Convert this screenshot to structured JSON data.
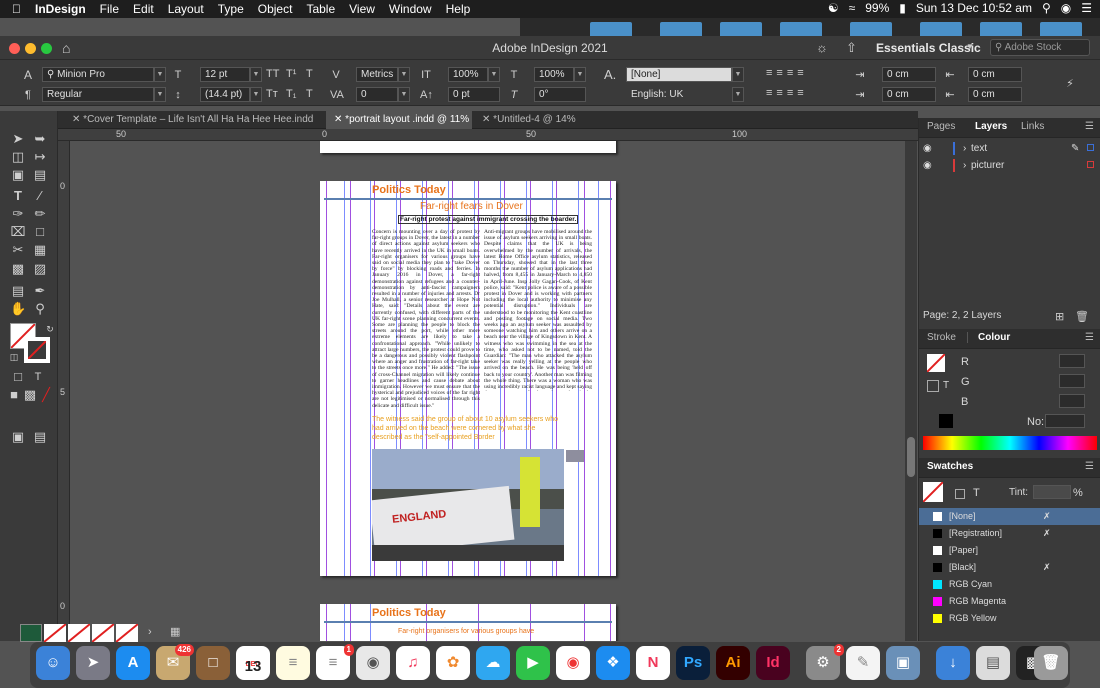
{
  "menubar": {
    "app": "InDesign",
    "items": [
      "File",
      "Edit",
      "Layout",
      "Type",
      "Object",
      "Table",
      "View",
      "Window",
      "Help"
    ],
    "battery": "99%",
    "datetime": "Sun 13 Dec  10:52 am"
  },
  "window": {
    "title": "Adobe InDesign 2021",
    "workspace": "Essentials Classic",
    "stock_placeholder": "Adobe Stock"
  },
  "control": {
    "font_family": "Minion Pro",
    "font_style": "Regular",
    "font_size": "12 pt",
    "leading": "(14.4 pt)",
    "kerning": "Metrics",
    "tracking": "0",
    "vscale": "100%",
    "hscale": "100%",
    "baseline": "0 pt",
    "skew": "0°",
    "char_style": "[None]",
    "language": "English: UK",
    "indent_left": "0 cm",
    "indent_right": "0 cm",
    "indent_first": "0 cm",
    "indent_last": "0 cm"
  },
  "tabs": [
    {
      "label": "*Cover Template – Life Isn't All Ha Ha Hee Hee.indd @ 37%",
      "active": false
    },
    {
      "label": "*portrait layout .indd @ 11%",
      "active": true
    },
    {
      "label": "*Untitled-4 @ 14%",
      "active": false
    }
  ],
  "ruler": {
    "marks": [
      "50",
      "0",
      "50",
      "100"
    ],
    "vmarks": [
      "0",
      "5",
      "0"
    ]
  },
  "document": {
    "masthead": "Politics Today",
    "headline": "Far-right fears in Dover",
    "subhead": "Far-right protest against immigrant crossing the boarder.",
    "col1": "Concern is mounting over a day of protest by far-right groups in Dover, the latest in a number of direct actions against asylum seekers who have recently arrived in the UK in small boats. Far-right organisers for various groups have said on social media they plan to \"take Dover by force\" by blocking roads and ferries. In January 2016 in Dover, a far-right demonstration against refugees and a counter-demonstration by anti-fascist campaigners resulted in a number of injuries and arrests. Dr Joe Mulhall, a senior researcher at Hope Not Hate, said: \"Details about the event are currently confused, with different parts of the UK far-right scene planning concurrent events. Some are planning the people to block the streets around the port, while other more extreme elements are likely to take a confrontational approach. \"While unlikely to attract large numbers, the protest could prove to be a dangerous and possibly violent flashpoint where an anger and frustration of far-right take to the streets once more.\" He added: \"The issue of cross-Channel migration will likely continue to garner headlines and cause debate about immigration. However we must ensure that the hysterical and prejudiced voices of the far right are not legitimised or normalised through this delicate and difficult issue.\"",
    "col2": "Anti-migrant groups have mobilised around the issue of asylum seekers arriving in small boats. Despite claims that the UK is being overwhelmed by the number of arrivals, the latest Home Office asylum statistics, released on Thursday, showed that in the last three months the number of asylum applications had halved, from 8,455 in January-March to 4,850 in April-June. Insp Jolly Gagan-Cook, of Kent police, said: \"Kent police is aware of a possible protest in Dover and is working with partners including the local authority to minimise any potential disruption.\" Individuals are understood to be monitoring the Kent coastline and posting footage on social media. Two weeks ago an asylum seeker was assaulted by someone watching him and others arrive on a beach near the village of Kingsdown in Kent. A witness who was swimming in the sea at the time, who asked not to be named, told the Guardian: \"The man who attacked the asylum seeker was really yelling at the people who arrived on the beach. He was being 'held off back to your country'. Another man was filming the whole thing. There was a woman who was using incredibly racist language and kept saying there was no space for the asylum seekers in the UK.\"",
    "pullquote": "The witness said the group of about 10 asylum seekers who had arrived on the beach were cornered by what she described as the \"self-appointed Border",
    "image_text": "ENGLAND",
    "page2_masthead": "Politics Today",
    "page2_headline": "Far-right organisers for various groups have"
  },
  "layers_panel": {
    "tabs": [
      "Pages",
      "Layers",
      "Links"
    ],
    "layers": [
      {
        "name": "text",
        "color": "#3a6fd8"
      },
      {
        "name": "picturer",
        "color": "#d83a3a"
      }
    ],
    "footer": "Page: 2, 2 Layers"
  },
  "colour_panel": {
    "tabs": [
      "Stroke",
      "Colour"
    ],
    "channels": [
      "R",
      "G",
      "B"
    ],
    "no_label": "No:"
  },
  "swatches_panel": {
    "title": "Swatches",
    "tint_label": "Tint:",
    "tint_unit": "%",
    "items": [
      {
        "name": "[None]",
        "color": "#ffffff",
        "selected": true
      },
      {
        "name": "[Registration]",
        "color": "#000000"
      },
      {
        "name": "[Paper]",
        "color": "#ffffff"
      },
      {
        "name": "[Black]",
        "color": "#000000"
      },
      {
        "name": "RGB Cyan",
        "color": "#00e5ff"
      },
      {
        "name": "RGB Magenta",
        "color": "#ff00ff"
      },
      {
        "name": "RGB Yellow",
        "color": "#ffff00"
      }
    ]
  },
  "dock": {
    "mail_badge": "426",
    "cal_month": "DEC",
    "cal_day": "13",
    "reminders_badge": "1",
    "prefs_badge": "2",
    "ps": "Ps",
    "ai": "Ai",
    "id": "Id"
  },
  "colors": {
    "accent": "#e8731a",
    "guide": "#a050e0"
  }
}
